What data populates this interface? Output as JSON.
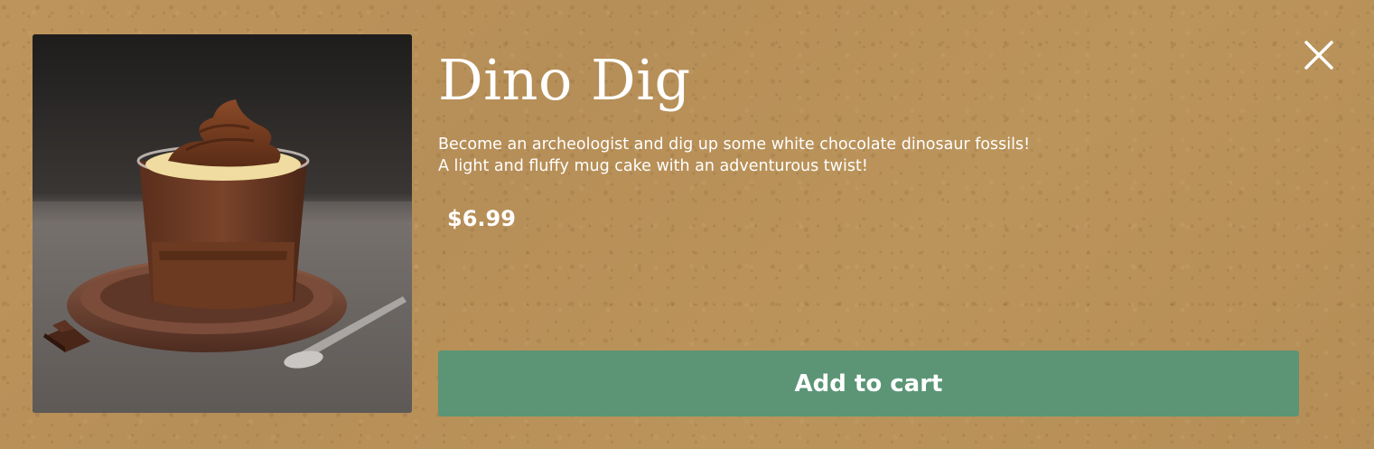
{
  "product": {
    "title": "Dino Dig",
    "description": "Become an archeologist and dig up some white chocolate dinosaur fossils! A light and fluffy mug cake with an adventurous twist!",
    "price": "$6.99",
    "image_icon": "chocolate-mug-cake-photo"
  },
  "actions": {
    "add_to_cart_label": "Add to cart",
    "close_icon": "close-icon"
  },
  "colors": {
    "background": "#b8915a",
    "button": "#5b9575",
    "text": "#ffffff"
  }
}
